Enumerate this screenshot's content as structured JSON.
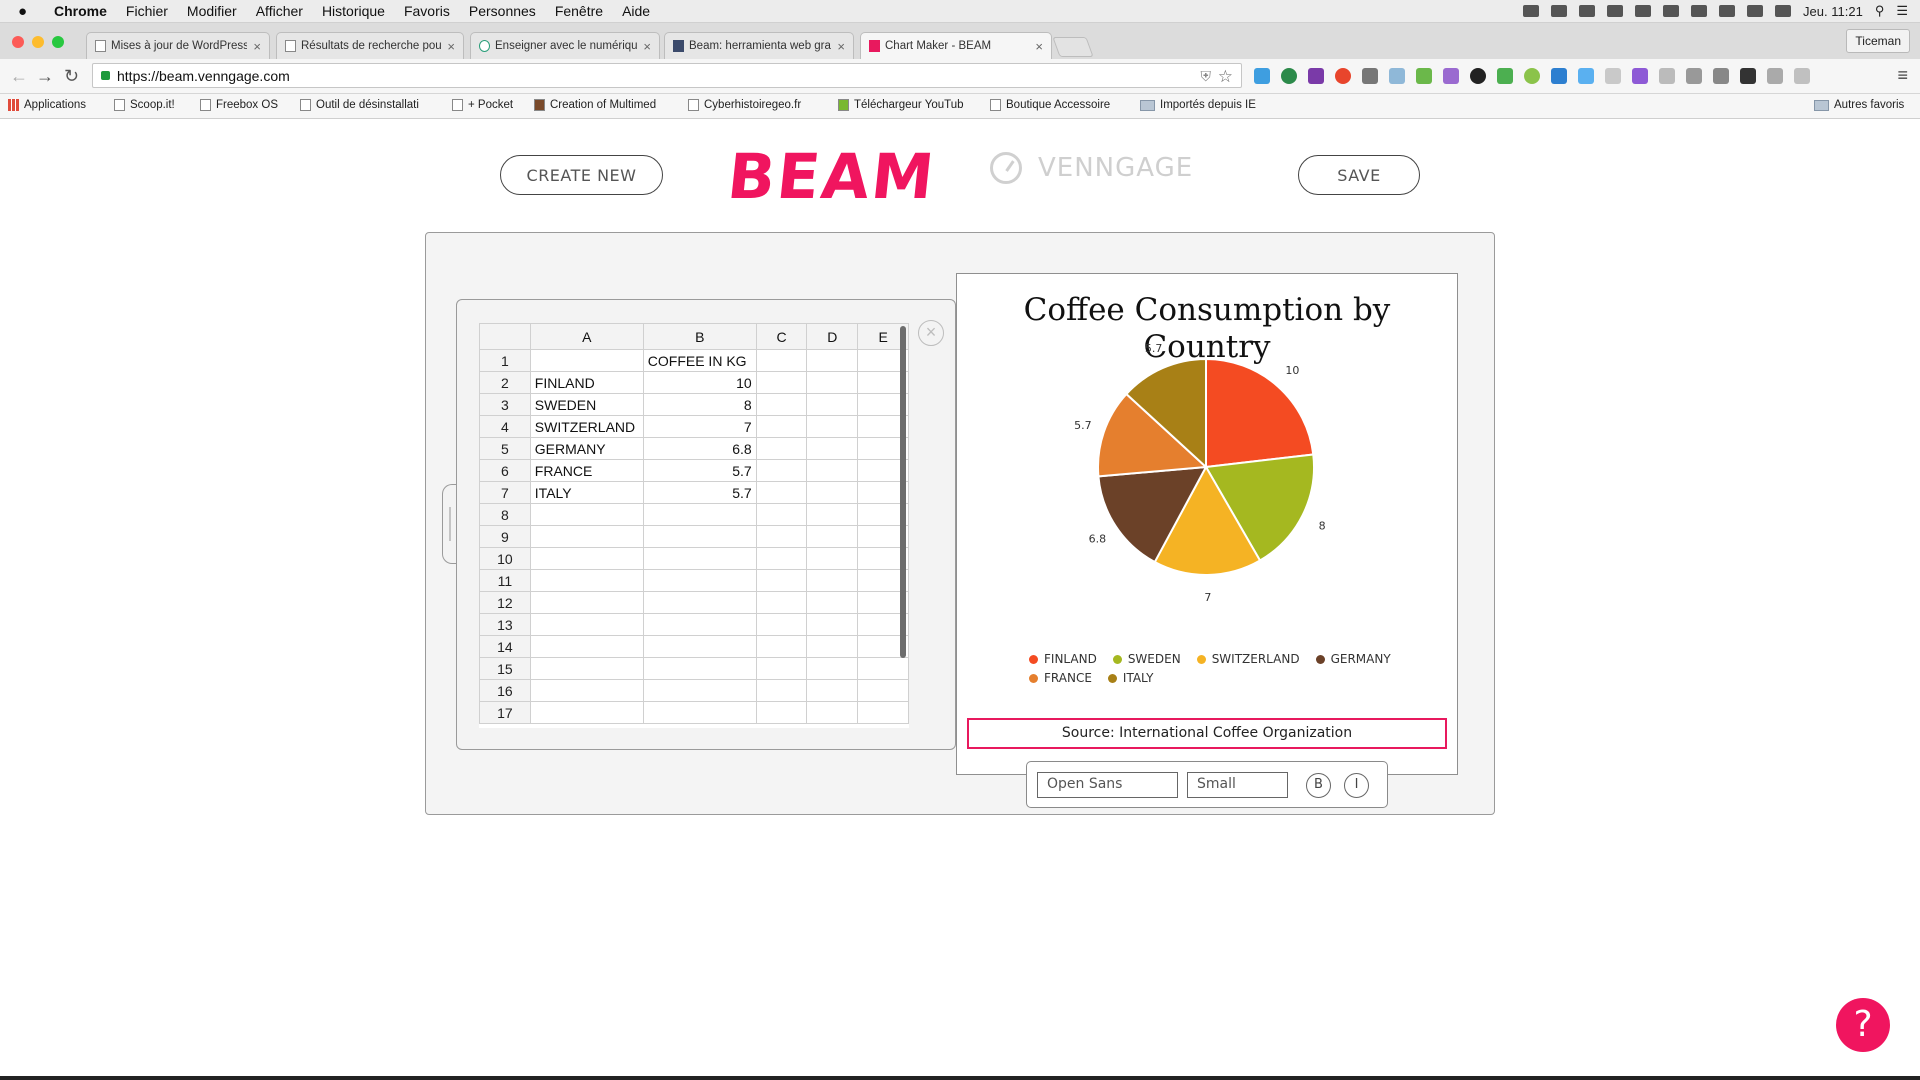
{
  "menubar": {
    "apple": "",
    "items": [
      "Chrome",
      "Fichier",
      "Modifier",
      "Afficher",
      "Historique",
      "Favoris",
      "Personnes",
      "Fenêtre",
      "Aide"
    ],
    "clock": "Jeu. 11:21"
  },
  "tabs": [
    {
      "label": "Mises à jour de WordPress",
      "active": false
    },
    {
      "label": "Résultats de recherche pour",
      "active": false
    },
    {
      "label": "Enseigner avec le numérique",
      "active": false
    },
    {
      "label": "Beam: herramienta web gratuita",
      "active": false
    },
    {
      "label": "Chart Maker - BEAM",
      "active": true
    }
  ],
  "profile_name": "Ticeman",
  "address_bar": {
    "url": "https://beam.venngage.com"
  },
  "bookmarks": [
    "Applications",
    "Scoop.it!",
    "Freebox OS",
    "Outil de désinstallati",
    "+ Pocket",
    "Creation of Multimed",
    "Cyberhistoiregeo.fr",
    "Téléchargeur YouTub",
    "Boutique Accessoire",
    "Importés depuis IE",
    "Autres favoris"
  ],
  "app": {
    "create_new": "CREATE NEW",
    "logo": "BEAM",
    "venngage": "VENNGAGE",
    "save": "SAVE"
  },
  "sheet": {
    "columns": [
      "A",
      "B",
      "C",
      "D",
      "E"
    ],
    "rows": [
      {
        "n": "1",
        "a": "",
        "b": "COFFEE IN KG"
      },
      {
        "n": "2",
        "a": "FINLAND",
        "b": "10"
      },
      {
        "n": "3",
        "a": "SWEDEN",
        "b": "8"
      },
      {
        "n": "4",
        "a": "SWITZERLAND",
        "b": "7"
      },
      {
        "n": "5",
        "a": "GERMANY",
        "b": "6.8"
      },
      {
        "n": "6",
        "a": "FRANCE",
        "b": "5.7"
      },
      {
        "n": "7",
        "a": "ITALY",
        "b": "5.7"
      },
      {
        "n": "8",
        "a": "",
        "b": ""
      },
      {
        "n": "9",
        "a": "",
        "b": ""
      },
      {
        "n": "10",
        "a": "",
        "b": ""
      },
      {
        "n": "11",
        "a": "",
        "b": ""
      },
      {
        "n": "12",
        "a": "",
        "b": ""
      },
      {
        "n": "13",
        "a": "",
        "b": ""
      },
      {
        "n": "14",
        "a": "",
        "b": ""
      },
      {
        "n": "15",
        "a": "",
        "b": ""
      },
      {
        "n": "16",
        "a": "",
        "b": ""
      },
      {
        "n": "17",
        "a": "",
        "b": ""
      }
    ]
  },
  "chart_data": {
    "type": "pie",
    "title": "Coffee Consumption by Country",
    "categories": [
      "FINLAND",
      "SWEDEN",
      "SWITZERLAND",
      "GERMANY",
      "FRANCE",
      "ITALY"
    ],
    "values": [
      10,
      8,
      7,
      6.8,
      5.7,
      5.7
    ],
    "colors": [
      "#f44b22",
      "#a5b820",
      "#f5b324",
      "#6b4128",
      "#e57f2e",
      "#a88016"
    ],
    "legend": "bottom",
    "source": "Source: International Coffee Organization"
  },
  "text_toolbar": {
    "font": "Open Sans",
    "size": "Small",
    "bold": "B",
    "italic": "I"
  },
  "help": "?"
}
